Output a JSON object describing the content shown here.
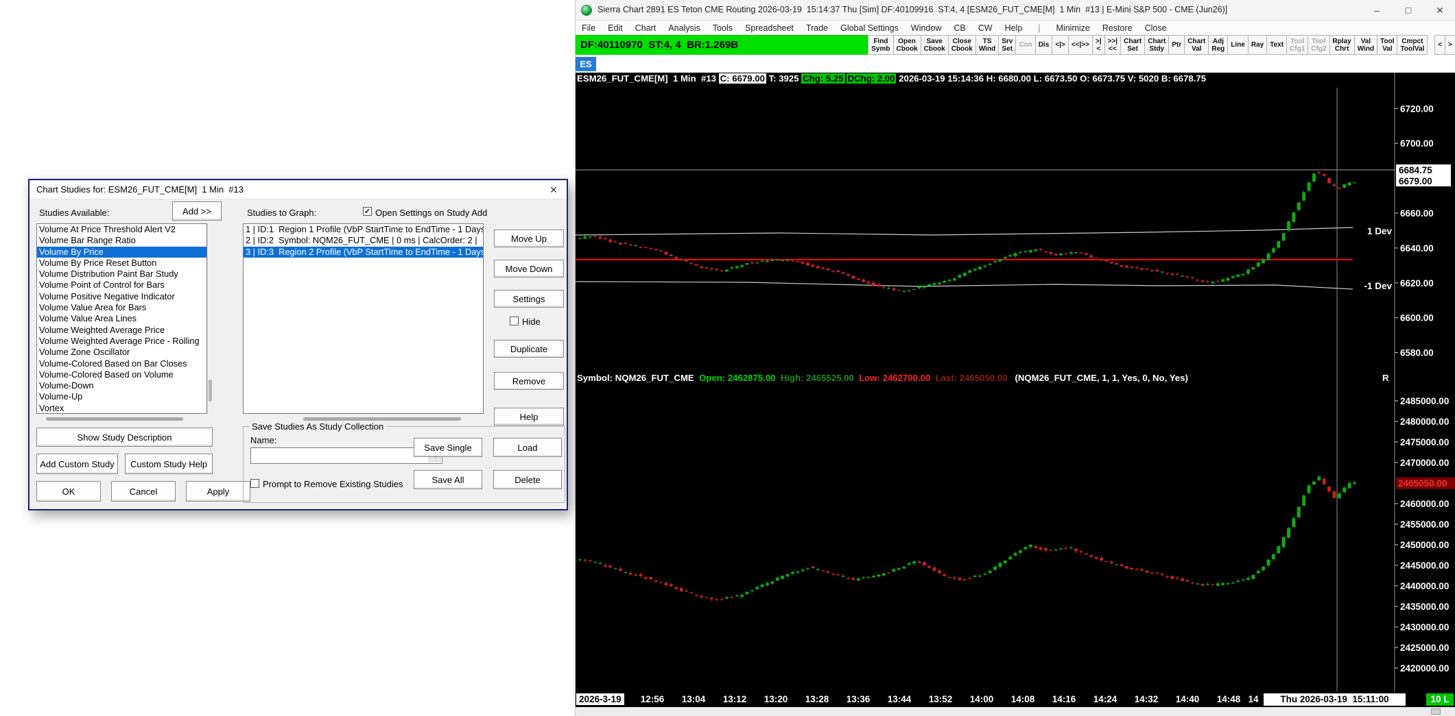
{
  "window": {
    "title": "Sierra Chart 2891 ES Teton CME Routing 2026-03-19  15:14:37 Thu [Sim] DF:40109916  ST:4, 4 [ESM26_FUT_CME[M]  1 Min  #13 | E-Mini S&P 500 - CME (Jun26)]",
    "minimize": "–",
    "maximize": "□",
    "close": "✕",
    "menu": [
      "File",
      "Edit",
      "Chart",
      "Analysis",
      "Tools",
      "Spreadsheet",
      "Trade",
      "Global Settings",
      "Window",
      "CB",
      "CW",
      "Help",
      "|",
      "Minimize",
      "Restore",
      "Close"
    ],
    "status_bar": "DF:40110970  ST:4, 4  BR:1.269B",
    "toolbar": [
      {
        "label": "Find\nSymb"
      },
      {
        "label": "Open\nCbook"
      },
      {
        "label": "Save\nCbook"
      },
      {
        "label": "Close\nCbook"
      },
      {
        "label": "TS\nWind"
      },
      {
        "label": "Srv\nSet"
      },
      {
        "label": "Con",
        "disabled": true
      },
      {
        "label": "Dis"
      },
      {
        "label": "<|>"
      },
      {
        "label": "<<|>>"
      },
      {
        "label": ">|<"
      },
      {
        "label": ">>|<<"
      },
      {
        "label": "Chart\nSet"
      },
      {
        "label": "Chart\nStdy"
      },
      {
        "label": "Ptr"
      },
      {
        "label": "Chart\nVal"
      },
      {
        "label": "Adj\nReg"
      },
      {
        "label": "Line"
      },
      {
        "label": "Ray"
      },
      {
        "label": "Text"
      },
      {
        "label": "Tool\nCfg1",
        "disabled": true
      },
      {
        "label": "Tool\nCfg2",
        "disabled": true
      },
      {
        "label": "Rplay\nChrt"
      },
      {
        "label": "Val\nWind"
      },
      {
        "label": "Tool\nVal"
      },
      {
        "label": "Cmpct\nToolVal"
      },
      {
        "label": "<",
        "spaced": true
      },
      {
        "label": ">"
      }
    ],
    "chart_tab": "ES"
  },
  "chart": {
    "header_segments": [
      {
        "text": "ESM26_FUT_CME[M]  1 Min  #13 ",
        "fg": "#ffffff"
      },
      {
        "text": "C: 6679.00",
        "fg": "#000000",
        "bg": "#ffffff"
      },
      {
        "text": " T: 3925 ",
        "fg": "#ffffff"
      },
      {
        "text": "Chg: 5.25",
        "fg": "#000000",
        "bg": "#00c400"
      },
      {
        "text": "DChg: 2.00",
        "fg": "#000000",
        "bg": "#00c400",
        "gap": 2
      },
      {
        "text": " 2026-03-19 15:14:36 H: 6680.00 L: 6673.50 O: 6673.75 V: 5020 B: 6678.75",
        "fg": "#ffffff"
      }
    ],
    "symbol_segments": [
      {
        "text": "Symbol: NQM26_FUT_CME  ",
        "fg": "#ffffff"
      },
      {
        "text": "Open: 2462875.00  ",
        "fg": "#00d400"
      },
      {
        "text": "High: 2465525.00  ",
        "fg": "#1e8c1e"
      },
      {
        "text": "Low: 2462700.00  ",
        "fg": "#ff2222"
      },
      {
        "text": "Last: 2465050.00  ",
        "fg": "#8c1e1e"
      },
      {
        "text": " (NQM26_FUT_CME, 1, 1, Yes, 0, No, Yes)",
        "fg": "#ffffff"
      }
    ],
    "region_marker": "R",
    "dev_plus_label": "1 Dev",
    "dev_minus_label": "-1 Dev",
    "colors": {
      "up": "#11a811",
      "down": "#c32222",
      "vwap": "#ff0000",
      "dev": "#cdcdcd",
      "grid": "#a8a8a8",
      "axis_border": "#8c8c8c",
      "label": "#ffffff",
      "last_box_bg": "#7c0000",
      "last_box_fg": "#e83030"
    },
    "region1": {
      "axis_labels": [
        "6720.00",
        "6700.00",
        "6660.00",
        "6640.00",
        "6620.00",
        "6600.00",
        "6580.00"
      ],
      "boxed_labels": [
        "6684.75",
        "6679.00"
      ],
      "price_top": 6737,
      "price_bottom": 6572,
      "vwap_price": 6633.3,
      "dev_plus_price": 6648.5,
      "dev_minus_price": 6619.5,
      "hline_price": 6684.75,
      "waypoints": [
        [
          0,
          6645
        ],
        [
          0.02,
          6647
        ],
        [
          0.05,
          6643
        ],
        [
          0.08,
          6641
        ],
        [
          0.11,
          6638
        ],
        [
          0.13,
          6634
        ],
        [
          0.16,
          6629
        ],
        [
          0.19,
          6627
        ],
        [
          0.22,
          6631
        ],
        [
          0.25,
          6633
        ],
        [
          0.28,
          6633
        ],
        [
          0.31,
          6629
        ],
        [
          0.34,
          6626
        ],
        [
          0.37,
          6621
        ],
        [
          0.4,
          6617
        ],
        [
          0.42,
          6615
        ],
        [
          0.45,
          6618
        ],
        [
          0.48,
          6621
        ],
        [
          0.51,
          6627
        ],
        [
          0.54,
          6632
        ],
        [
          0.57,
          6637
        ],
        [
          0.595,
          6639
        ],
        [
          0.62,
          6636
        ],
        [
          0.645,
          6638
        ],
        [
          0.67,
          6634
        ],
        [
          0.7,
          6630
        ],
        [
          0.73,
          6628
        ],
        [
          0.76,
          6626
        ],
        [
          0.79,
          6623
        ],
        [
          0.815,
          6620
        ],
        [
          0.84,
          6622
        ],
        [
          0.865,
          6626
        ],
        [
          0.89,
          6634
        ],
        [
          0.91,
          6645
        ],
        [
          0.93,
          6663
        ],
        [
          0.945,
          6676
        ],
        [
          0.955,
          6684
        ],
        [
          0.965,
          6682
        ],
        [
          0.975,
          6676
        ],
        [
          0.985,
          6674
        ],
        [
          1,
          6678
        ]
      ]
    },
    "region2": {
      "axis_labels": [
        "2485000.00",
        "2480000.00",
        "2475000.00",
        "2470000.00",
        "2460000.00",
        "2455000.00",
        "2450000.00",
        "2445000.00",
        "2440000.00",
        "2435000.00",
        "2430000.00",
        "2425000.00",
        "2420000.00"
      ],
      "last_label": "2465050.00",
      "last_price": 2465050,
      "price_top": 2487000,
      "price_bottom": 2415500,
      "waypoints": [
        [
          0,
          2446500
        ],
        [
          0.03,
          2445500
        ],
        [
          0.06,
          2443500
        ],
        [
          0.09,
          2442000
        ],
        [
          0.12,
          2440000
        ],
        [
          0.15,
          2438000
        ],
        [
          0.18,
          2436500
        ],
        [
          0.21,
          2437500
        ],
        [
          0.24,
          2440000
        ],
        [
          0.27,
          2442500
        ],
        [
          0.3,
          2444500
        ],
        [
          0.33,
          2443000
        ],
        [
          0.36,
          2441500
        ],
        [
          0.39,
          2442500
        ],
        [
          0.42,
          2444500
        ],
        [
          0.44,
          2446000
        ],
        [
          0.46,
          2444000
        ],
        [
          0.48,
          2442000
        ],
        [
          0.5,
          2441500
        ],
        [
          0.53,
          2443000
        ],
        [
          0.56,
          2447000
        ],
        [
          0.585,
          2450000
        ],
        [
          0.61,
          2448500
        ],
        [
          0.635,
          2449500
        ],
        [
          0.66,
          2447500
        ],
        [
          0.69,
          2445500
        ],
        [
          0.72,
          2444000
        ],
        [
          0.75,
          2443000
        ],
        [
          0.78,
          2441500
        ],
        [
          0.81,
          2440000
        ],
        [
          0.84,
          2440500
        ],
        [
          0.87,
          2442000
        ],
        [
          0.89,
          2445000
        ],
        [
          0.91,
          2450000
        ],
        [
          0.93,
          2457500
        ],
        [
          0.945,
          2464000
        ],
        [
          0.96,
          2466500
        ],
        [
          0.97,
          2463500
        ],
        [
          0.98,
          2461500
        ],
        [
          1,
          2465050
        ]
      ]
    },
    "time_axis": {
      "date_box": "2026-3-19",
      "labels": [
        "12:56",
        "13:04",
        "13:12",
        "13:20",
        "13:28",
        "13:36",
        "13:44",
        "13:52",
        "14:00",
        "14:08",
        "14:16",
        "14:24",
        "14:32",
        "14:40",
        "14:48"
      ],
      "partial_label": "14",
      "datetime_box": "Thu 2026-03-19  15:11:00",
      "badge": "10 L"
    }
  },
  "dialog": {
    "title": "Chart Studies for: ESM26_FUT_CME[M]  1 Min  #13",
    "close": "✕",
    "studies_available_label": "Studies Available:",
    "add_button": "Add >>",
    "studies_to_graph_label": "Studies to Graph:",
    "open_settings_checkbox": "Open Settings on Study Add",
    "open_settings_checked": "✓",
    "available": [
      "Volume At Price Threshold Alert V2",
      "Volume Bar Range Ratio",
      "Volume By Price",
      "Volume By Price Reset Button",
      "Volume Distribution Paint Bar Study",
      "Volume Point of Control for Bars",
      "Volume Positive Negative Indicator",
      "Volume Value Area for Bars",
      "Volume Value Area Lines",
      "Volume Weighted Average Price",
      "Volume Weighted Average Price - Rolling",
      "Volume Zone Oscillator",
      "Volume-Colored Based on Bar Closes",
      "Volume-Colored Based on Volume",
      "Volume-Down",
      "Volume-Up",
      "Vortex"
    ],
    "selected_available_index": 2,
    "graphed": [
      "1 | ID:1  Region 1 Profile (VbP StartTime to EndTime - 1 Days",
      "2 | ID:2  Symbol: NQM26_FUT_CME | 0 ms | CalcOrder: 2 | ",
      "3 | ID:3  Region 2 Profile (VbP StartTime to EndTime - 1 Days"
    ],
    "selected_graphed_index": 2,
    "move_up": "Move Up",
    "move_down": "Move Down",
    "settings": "Settings",
    "hide_checkbox": "Hide",
    "duplicate": "Duplicate",
    "remove": "Remove",
    "help": "Help",
    "show_study_description": "Show Study Description",
    "add_custom_study": "Add Custom Study",
    "custom_study_help": "Custom Study Help",
    "ok": "OK",
    "cancel": "Cancel",
    "apply": "Apply",
    "group": {
      "title": "Save Studies As Study Collection",
      "name_label": "Name:",
      "name_value": "",
      "save_single": "Save Single",
      "load": "Load",
      "save_all": "Save All",
      "delete": "Delete",
      "prompt_checkbox": "Prompt to Remove Existing Studies"
    }
  }
}
